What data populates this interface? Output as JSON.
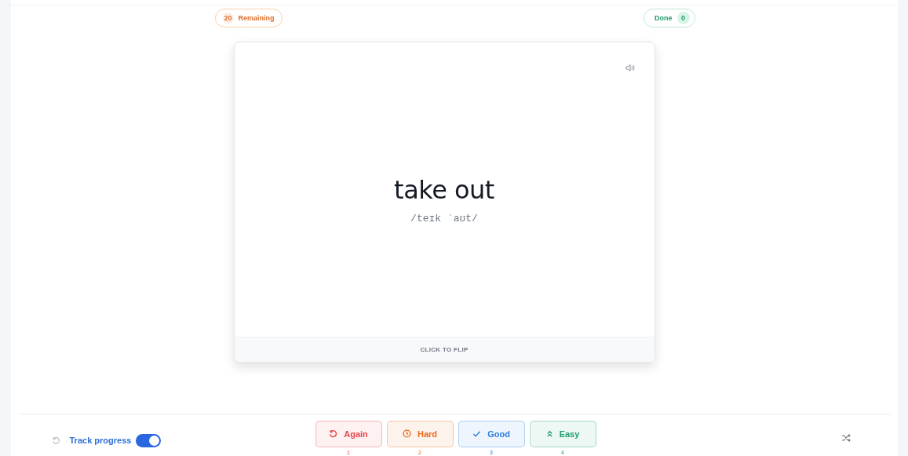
{
  "counters": {
    "remaining": {
      "count": "20",
      "label": "Remaining"
    },
    "done": {
      "label": "Done",
      "count": "0"
    }
  },
  "card": {
    "word": "take out",
    "pronunciation": "/teɪk ˈaʊt/",
    "flip_hint": "CLICK TO FLIP"
  },
  "footer": {
    "track_progress": {
      "label": "Track progress",
      "on": true
    },
    "ratings": [
      {
        "kind": "again",
        "label": "Again",
        "key": "1",
        "color": "#e5484d"
      },
      {
        "kind": "hard",
        "label": "Hard",
        "key": "2",
        "color": "#ea6a1c"
      },
      {
        "kind": "good",
        "label": "Good",
        "key": "3",
        "color": "#2b7de0"
      },
      {
        "kind": "easy",
        "label": "Easy",
        "key": "4",
        "color": "#1f9d6b"
      }
    ]
  }
}
